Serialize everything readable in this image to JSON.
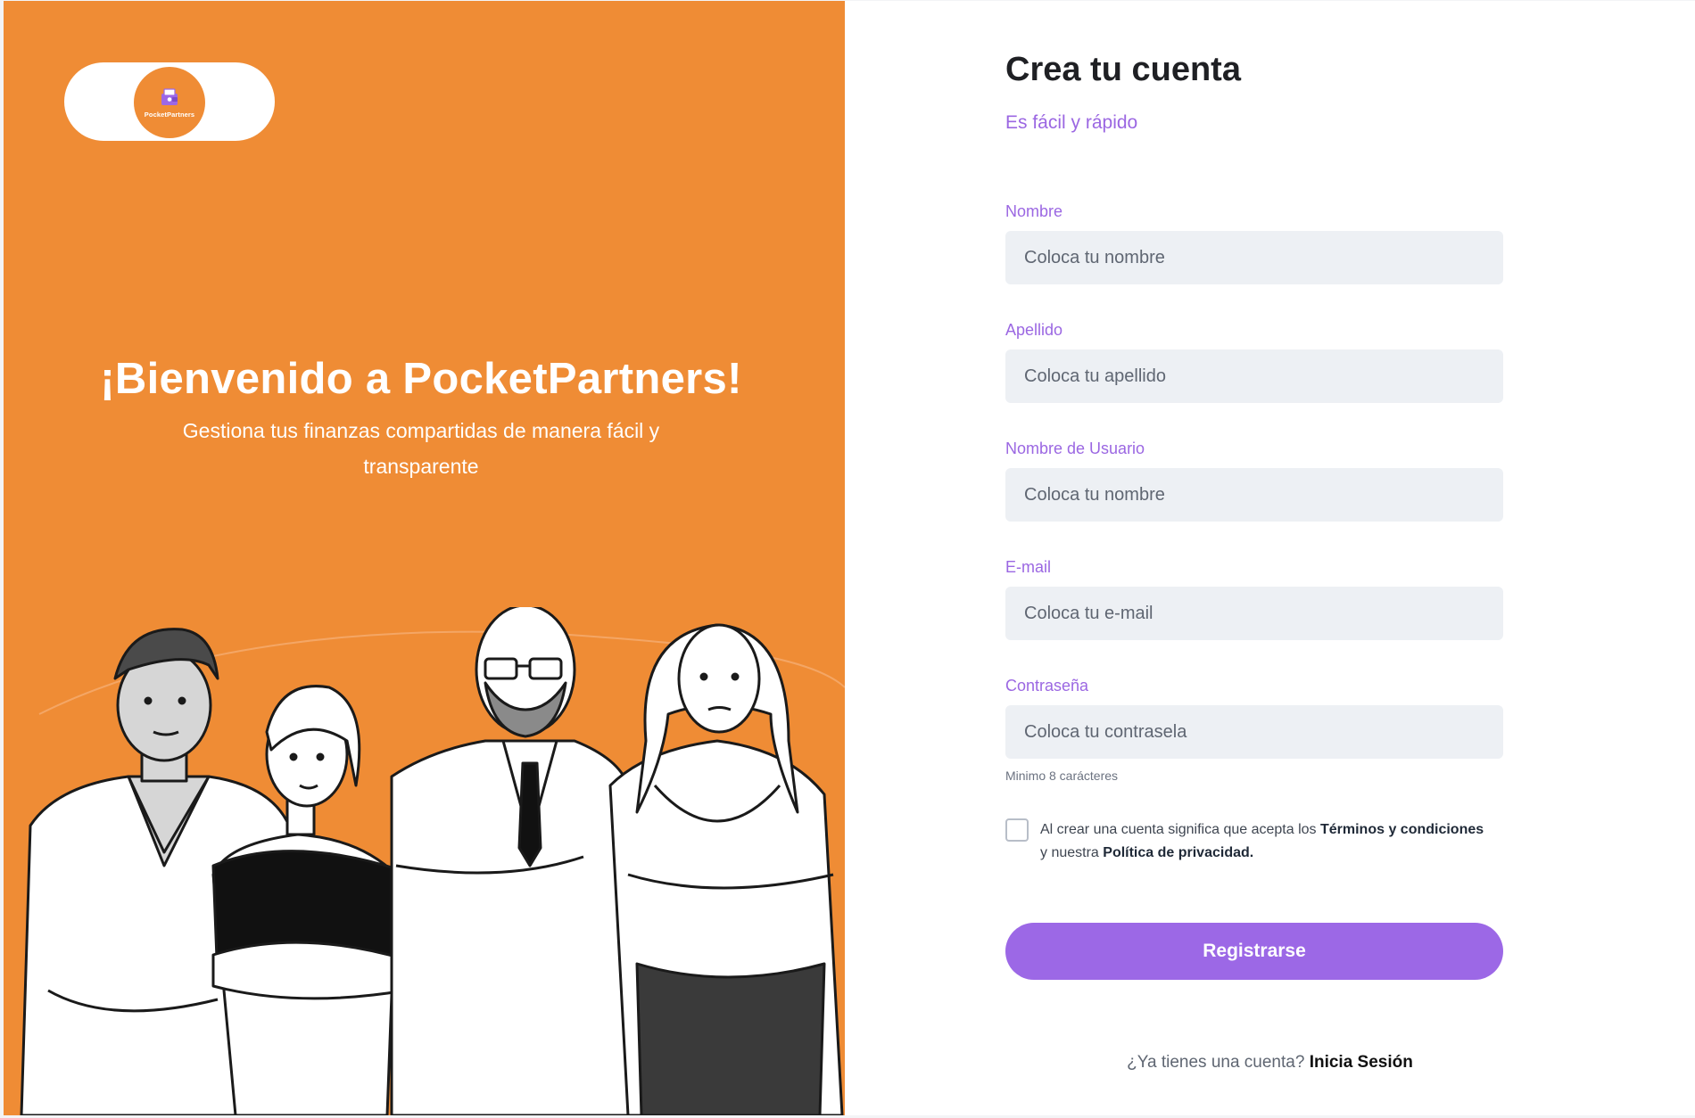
{
  "brand": {
    "logo_text": "PocketPartners",
    "primary_color": "#ef8c35",
    "accent_color": "#9c68e6"
  },
  "hero": {
    "title": "¡Bienvenido a PocketPartners!",
    "subtitle": "Gestiona tus finanzas compartidas de manera fácil y transparente"
  },
  "form": {
    "title": "Crea tu cuenta",
    "subtitle": "Es fácil y rápido",
    "fields": [
      {
        "label": "Nombre",
        "placeholder": "Coloca tu nombre"
      },
      {
        "label": "Apellido",
        "placeholder": "Coloca tu apellido"
      },
      {
        "label": "Nombre de Usuario",
        "placeholder": "Coloca tu nombre"
      },
      {
        "label": "E-mail",
        "placeholder": "Coloca tu e-mail"
      },
      {
        "label": "Contraseña",
        "placeholder": "Coloca tu contrasela"
      }
    ],
    "password_hint": "Minimo 8 carácteres",
    "terms": {
      "prefix": "Al crear una cuenta significa que acepta los",
      "terms_link": "Términos y condiciones",
      "middle": "y nuestra",
      "privacy_link": "Política de privacidad."
    },
    "submit_label": "Registrarse",
    "login_prompt": "¿Ya tienes una cuenta?",
    "login_link": "Inicia Sesión"
  }
}
